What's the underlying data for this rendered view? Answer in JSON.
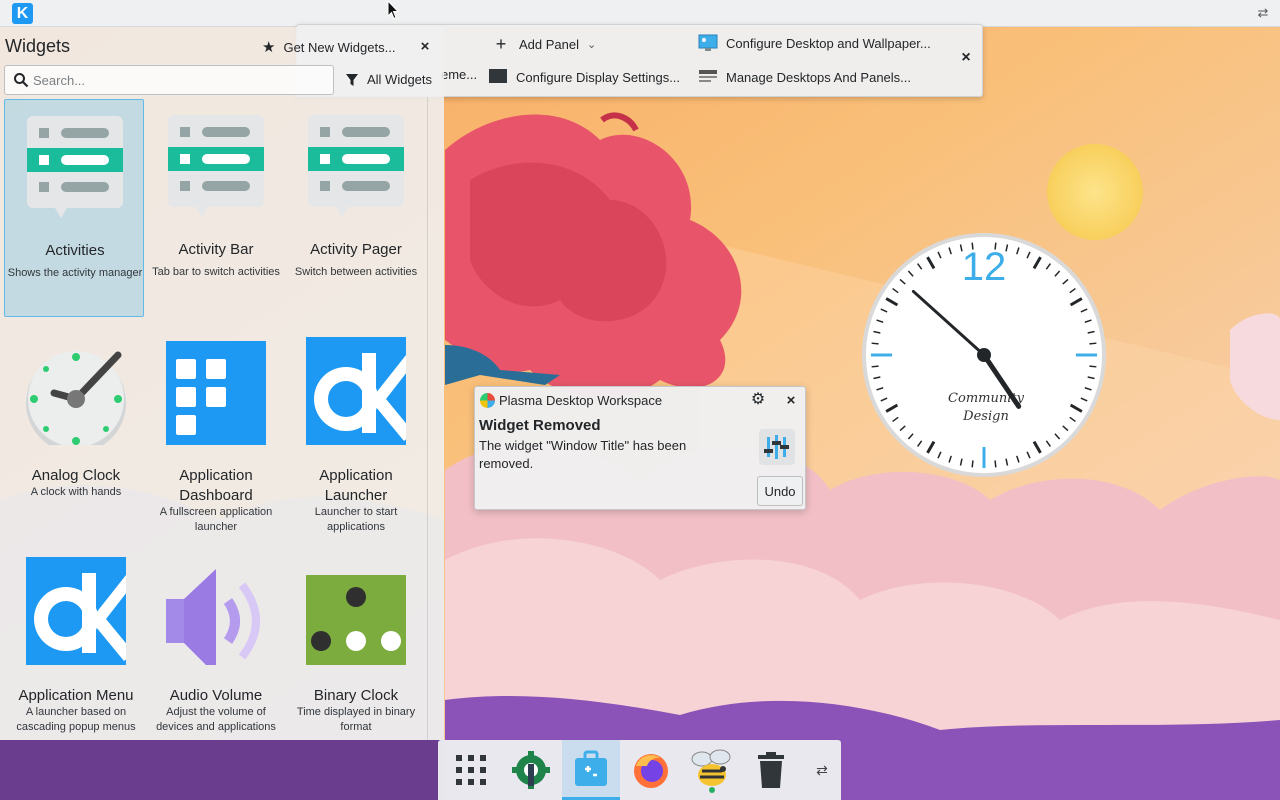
{
  "top_panel": {
    "logo_letter": "K",
    "config_glyph": "⇄"
  },
  "edit_toolbar": {
    "add_panel": "Add Panel",
    "configure_desktop": "Configure Desktop and Wallpaper...",
    "configure_display": "Configure Display Settings...",
    "manage_desktops": "Manage Desktops And Panels...",
    "partial_label": "eme...",
    "close_glyph": "×"
  },
  "widgets": {
    "title": "Widgets",
    "get_new": "Get New Widgets...",
    "close_glyph": "×",
    "search_placeholder": "Search...",
    "search_value": "",
    "filter_label": "All Widgets",
    "items": [
      {
        "name": "Activities",
        "desc": "Shows the activity manager",
        "icon": "activities-icon",
        "selected": true
      },
      {
        "name": "Activity Bar",
        "desc": "Tab bar to switch activities",
        "icon": "activity-bar-icon",
        "selected": false
      },
      {
        "name": "Activity Pager",
        "desc": "Switch between activities",
        "icon": "activity-pager-icon",
        "selected": false
      },
      {
        "name": "Analog Clock",
        "desc": "A clock with hands",
        "icon": "analog-clock-icon",
        "selected": false
      },
      {
        "name": "Application Dashboard",
        "desc": "A fullscreen application launcher",
        "icon": "app-dashboard-icon",
        "selected": false
      },
      {
        "name": "Application Launcher",
        "desc": "Launcher to start applications",
        "icon": "app-launcher-icon",
        "selected": false
      },
      {
        "name": "Application Menu",
        "desc": "A launcher based on cascading popup menus",
        "icon": "app-menu-icon",
        "selected": false
      },
      {
        "name": "Audio Volume",
        "desc": "Adjust the volume of devices and applications",
        "icon": "audio-volume-icon",
        "selected": false
      },
      {
        "name": "Binary Clock",
        "desc": "Time displayed in binary format",
        "icon": "binary-clock-icon",
        "selected": false
      }
    ]
  },
  "notification": {
    "app_name": "Plasma Desktop Workspace",
    "title": "Widget Removed",
    "body": "The widget \"Window Title\" has been removed.",
    "undo_label": "Undo",
    "close_glyph": "×",
    "gear_glyph": "⚙"
  },
  "desktop_clock": {
    "twelve": "12",
    "brand_line1": "Community",
    "brand_line2": "Design",
    "hour": 4,
    "minute": 52
  },
  "taskbar": {
    "config_glyph": "⇄",
    "items": [
      {
        "icon": "app-grid-icon",
        "active": false
      },
      {
        "icon": "plasma-settings-icon",
        "active": false
      },
      {
        "icon": "discover-store-icon",
        "active": true
      },
      {
        "icon": "firefox-icon",
        "active": false
      },
      {
        "icon": "bee-app-icon",
        "active": false
      },
      {
        "icon": "trash-icon",
        "active": false
      }
    ]
  },
  "colors": {
    "accent": "#3daee9",
    "kde_blue": "#1d99f3",
    "teal": "#1abc9c",
    "sky_top": "#f7c8a0",
    "tree_red": "#e8556a"
  }
}
